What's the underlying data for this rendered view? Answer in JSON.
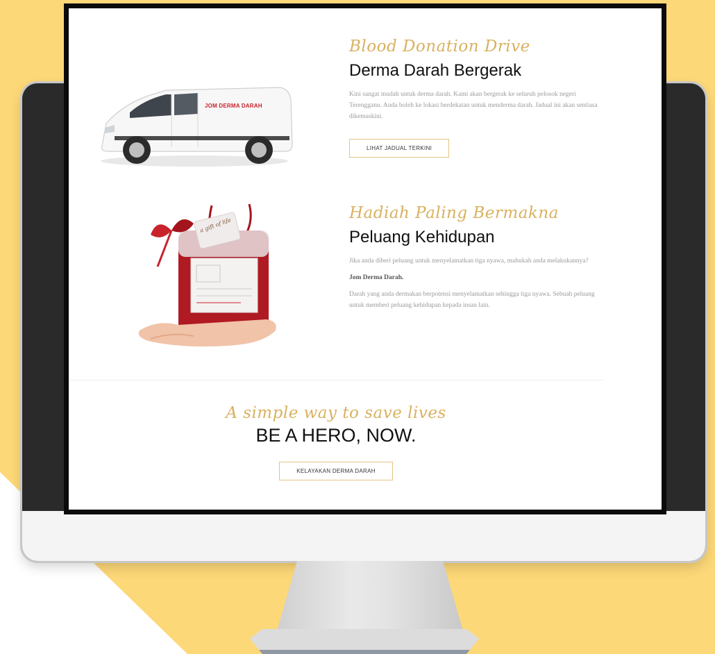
{
  "section1": {
    "script_title": "Blood Donation Drive",
    "heading": "Derma Darah Bergerak",
    "body": "Kini sangat mudah untuk derma darah. Kami akan bergerak ke seluruh pelosok negeri Terengganu. Anda boleh ke lokasi berdekatan untuk menderma darah. Jadual ini akan sentiasa dikemaskini.",
    "button_label": "LIHAT JADUAL TERKINI",
    "van_text": "JOM DERMA DARAH"
  },
  "section2": {
    "script_title": "Hadiah Paling Bermakna",
    "heading": "Peluang Kehidupan",
    "body1": "Jika anda diberi peluang untuk menyelamatkan tiga nyawa, mahukah anda melakukannya?",
    "body2": "Jom Derma Darah.",
    "body3": "Darah yang anda dermakan berpotensi menyelamatkan sehingga tiga nyawa. Sebuah peluang untuk memberi peluang kehidupan kepada insan lain.",
    "tag_text": "a gift of life"
  },
  "hero": {
    "script_title": "A simple way to save lives",
    "heading": "BE A HERO, NOW.",
    "button_label": "KELAYAKAN DERMA DARAH"
  },
  "colors": {
    "accent_gold": "#d9b15f",
    "backdrop_yellow": "#FDD878",
    "blood_red": "#b01a22"
  }
}
